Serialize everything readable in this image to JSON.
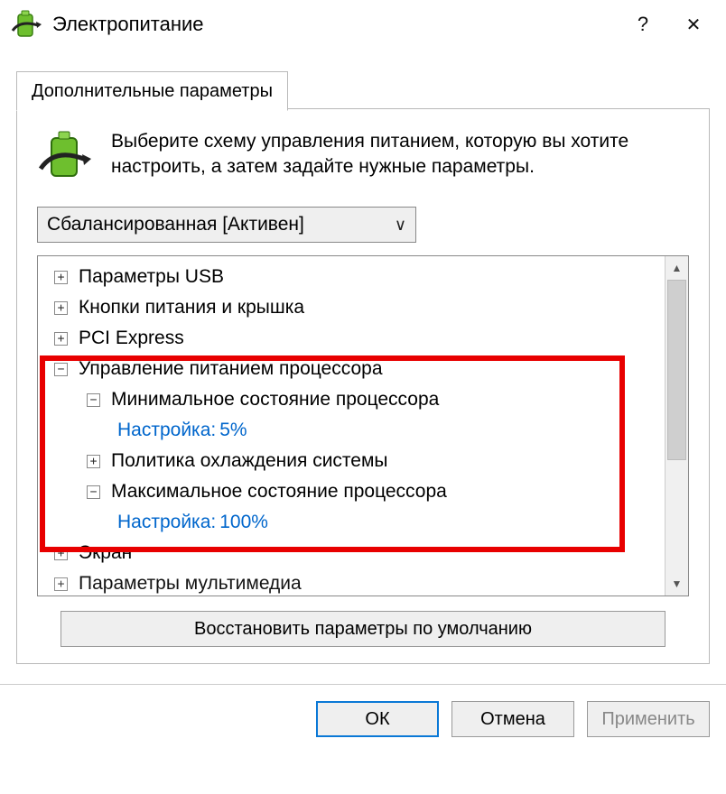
{
  "title": "Электропитание",
  "tab_label": "Дополнительные параметры",
  "intro_text": "Выберите схему управления питанием, которую вы хотите настроить, а затем задайте нужные параметры.",
  "plan_selected": "Сбалансированная [Активен]",
  "tree": {
    "n0": "Параметры USB",
    "n1": "Кнопки питания и крышка",
    "n2": "PCI Express",
    "n3": "Управление питанием процессора",
    "n3a": "Минимальное состояние процессора",
    "n3a_set_label": "Настройка:",
    "n3a_set_value": "5%",
    "n3b": "Политика охлаждения системы",
    "n3c": "Максимальное состояние процессора",
    "n3c_set_label": "Настройка:",
    "n3c_set_value": "100%",
    "n4": "Экран",
    "n5": "Параметры мультимедиа"
  },
  "restore_button": "Восстановить параметры по умолчанию",
  "buttons": {
    "ok": "ОК",
    "cancel": "Отмена",
    "apply": "Применить"
  },
  "glyph": {
    "plus": "+",
    "minus": "−",
    "chev_down": "∨",
    "tri_up": "▲",
    "tri_down": "▼",
    "help": "?",
    "close": "✕"
  }
}
